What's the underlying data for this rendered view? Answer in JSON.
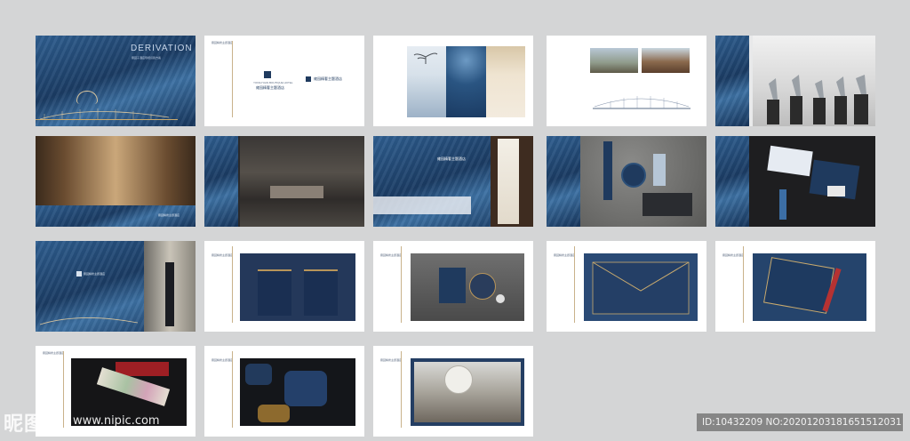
{
  "cover": {
    "title": "DERIVATION",
    "subtitle": "雍园子酒店导视识别方案"
  },
  "brand": {
    "name_cn": "雍园精奢主题酒店",
    "name_en": "YONGYUAN BOUTIQUE HOTEL"
  },
  "colors": {
    "navy": "#1f3a5e",
    "gold": "#b8955a",
    "background": "#d4d5d6"
  },
  "watermark": {
    "site_name": "昵图网",
    "url": "www.nipic.com"
  },
  "image_id": "ID:10432209 NO:20201203181651512031"
}
